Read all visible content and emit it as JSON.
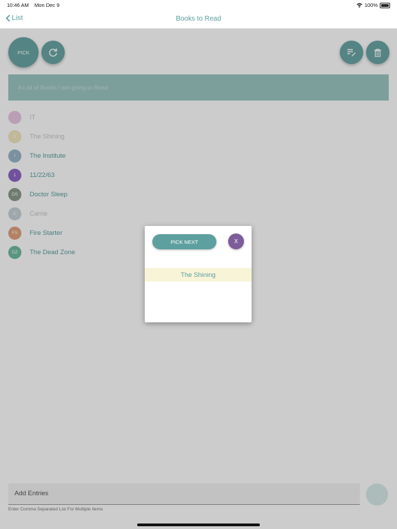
{
  "status_bar": {
    "time": "10:46 AM",
    "date": "Mon Dec 9",
    "battery": "100%"
  },
  "nav": {
    "back_label": "List",
    "title": "Books to Read"
  },
  "toolbar": {
    "pick_label": "PICK",
    "refresh_icon": "refresh-icon",
    "edit_icon": "edit-list-icon",
    "delete_icon": "trash-icon"
  },
  "description": "A List of Books I am going to Read",
  "items": [
    {
      "initials": "",
      "label": "IT",
      "avatar_color": "#e8c7e4",
      "label_color": "#c7c7c7"
    },
    {
      "initials": "S",
      "label": "The Shining",
      "avatar_color": "#f1e6bd",
      "label_color": "#c7c7c7"
    },
    {
      "initials": "I",
      "label": "The Institute",
      "avatar_color": "#9ab6c9",
      "label_color": "#5a9ea0"
    },
    {
      "initials": "1",
      "label": "11/22/63",
      "avatar_color": "#8d67c7",
      "label_color": "#5a9ea0"
    },
    {
      "initials": "DS",
      "label": "Doctor Sleep",
      "avatar_color": "#8d9a8d",
      "label_color": "#5a9ea0"
    },
    {
      "initials": "C",
      "label": "Carrie",
      "avatar_color": "#c6d2d7",
      "label_color": "#c7c7c7"
    },
    {
      "initials": "FS",
      "label": "Fire Starter",
      "avatar_color": "#e0a27c",
      "label_color": "#5a9ea0"
    },
    {
      "initials": "DZ",
      "label": "The Dead Zone",
      "avatar_color": "#6fbca0",
      "label_color": "#5a9ea0"
    }
  ],
  "entry": {
    "placeholder": "Add Entries",
    "helper": "Enter Comma Separated List For Multiple Items"
  },
  "modal": {
    "pick_next_label": "PICK NEXT",
    "close_label": "X",
    "result": "The Shining"
  },
  "colors": {
    "accent": "#5a9ea0",
    "close": "#7d5c9a",
    "result_bg": "#f8f4d8"
  }
}
